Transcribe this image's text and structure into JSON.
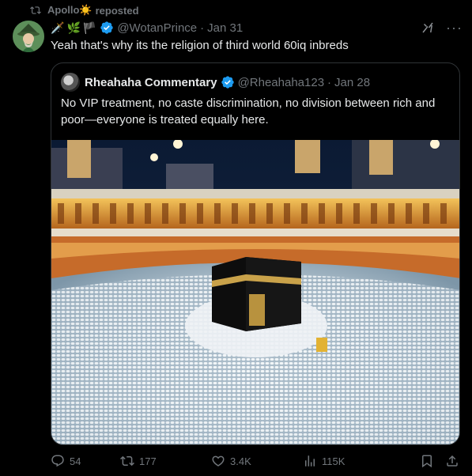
{
  "repost": {
    "user": "Apollo☀️",
    "label": "reposted"
  },
  "post": {
    "name_emojis": [
      "🗡️",
      "🌿",
      "🏴"
    ],
    "handle": "@WotanPrince",
    "separator": "·",
    "date": "Jan 31",
    "text": "Yeah that's why its the religion of third world 60iq inbreds"
  },
  "quote": {
    "name": "Rheahaha Commentary",
    "handle": "@Rheahaha123",
    "separator": "·",
    "date": "Jan 28",
    "text": "No VIP treatment, no caste discrimination, no division between rich and poor—everyone is treated equally here."
  },
  "actions": {
    "replies": "54",
    "reposts": "177",
    "likes": "3.4K",
    "views": "115K"
  },
  "icons": {
    "repost": "repost-icon",
    "verified": "verified-badge-icon",
    "grok": "grok-icon",
    "more": "more-icon",
    "reply": "reply-icon",
    "like": "heart-icon",
    "views": "views-icon",
    "bookmark": "bookmark-icon",
    "share": "share-icon"
  },
  "colors": {
    "background": "#000000",
    "text": "#e7e9ea",
    "secondary": "#71767b",
    "verified": "#1d9bf0",
    "border": "#2f3336"
  }
}
